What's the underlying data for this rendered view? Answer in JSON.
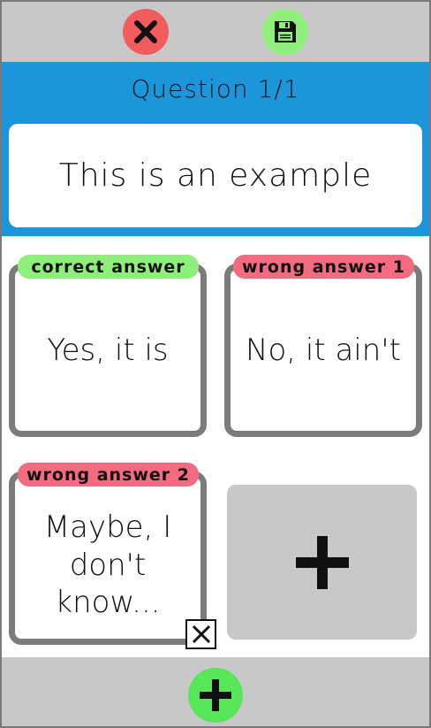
{
  "colors": {
    "toolbar_bg": "#c8c8c8",
    "question_bg": "#1b96db",
    "cancel": "#f25c5c",
    "save": "#8ef07a",
    "correct_tag": "#8ef07a",
    "wrong_tag": "#f26b7e",
    "add_question": "#57e657"
  },
  "toolbar": {
    "cancel_icon": "close-icon",
    "save_icon": "floppy-disk-icon"
  },
  "question": {
    "header": "Question 1/1",
    "text": "This is an example"
  },
  "answers": [
    {
      "tag": "correct answer",
      "text": "Yes, it is"
    },
    {
      "tag": "wrong answer 1",
      "text": "No, it ain't"
    },
    {
      "tag": "wrong answer 2",
      "text": "Maybe, I don't know..."
    }
  ],
  "add_answer_icon": "plus-icon",
  "delete_answer_icon": "close-box-icon",
  "bottom": {
    "add_question_icon": "plus-icon"
  }
}
